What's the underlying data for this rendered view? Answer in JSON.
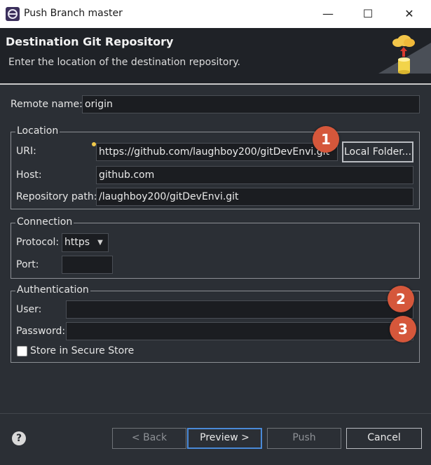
{
  "window": {
    "title": "Push Branch master",
    "minimize_glyph": "—",
    "maximize_glyph": "☐",
    "close_glyph": "✕"
  },
  "header": {
    "title": "Destination Git Repository",
    "description": "Enter the location of the destination repository."
  },
  "remote": {
    "label": "Remote name:",
    "value": "origin"
  },
  "location": {
    "legend": "Location",
    "uri_label": "URI:",
    "uri_value": "https://github.com/laughboy200/gitDevEnvi.git",
    "host_label": "Host:",
    "host_value": "github.com",
    "repo_path_label": "Repository path:",
    "repo_path_value": "/laughboy200/gitDevEnvi.git",
    "local_folder_button": "Local Folder..."
  },
  "connection": {
    "legend": "Connection",
    "protocol_label": "Protocol:",
    "protocol_value": "https",
    "port_label": "Port:",
    "port_value": ""
  },
  "authentication": {
    "legend": "Authentication",
    "user_label": "User:",
    "user_value": "",
    "password_label": "Password:",
    "password_value": "",
    "store_label": "Store in Secure Store",
    "store_checked": false
  },
  "annotations": {
    "m1": "1",
    "m2": "2",
    "m3": "3",
    "color": "#d5573b"
  },
  "footer": {
    "help_glyph": "?",
    "back": "< Back",
    "preview": "Preview >",
    "push": "Push",
    "cancel": "Cancel"
  },
  "colors": {
    "background": "#2b2f35",
    "banner": "#1f2227",
    "focus": "#4a8ad8"
  }
}
